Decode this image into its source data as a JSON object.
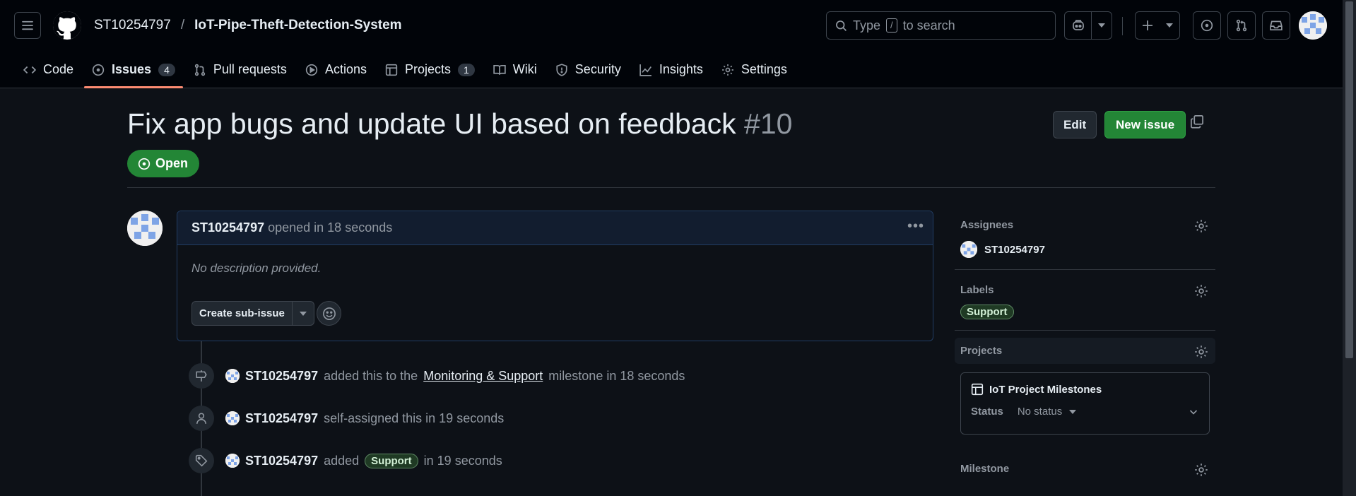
{
  "header": {
    "owner": "ST10254797",
    "separator": "/",
    "repo": "IoT-Pipe-Theft-Detection-System",
    "search_prefix": "Type",
    "search_key": "/",
    "search_suffix": "to search"
  },
  "nav": {
    "tabs": [
      {
        "label": "Code",
        "icon": "code-icon"
      },
      {
        "label": "Issues",
        "icon": "issue-icon",
        "count": "4"
      },
      {
        "label": "Pull requests",
        "icon": "pull-request-icon"
      },
      {
        "label": "Actions",
        "icon": "play-icon"
      },
      {
        "label": "Projects",
        "icon": "table-icon",
        "count": "1"
      },
      {
        "label": "Wiki",
        "icon": "book-icon"
      },
      {
        "label": "Security",
        "icon": "shield-icon"
      },
      {
        "label": "Insights",
        "icon": "graph-icon"
      },
      {
        "label": "Settings",
        "icon": "gear-icon"
      }
    ]
  },
  "issue": {
    "title": "Fix app bugs and update UI based on feedback",
    "number": "#10",
    "state": "Open",
    "edit_label": "Edit",
    "new_issue_label": "New issue"
  },
  "comment": {
    "author": "ST10254797",
    "meta": "opened in 18 seconds",
    "body": "No description provided.",
    "sub_issue_label": "Create sub-issue"
  },
  "events": [
    {
      "user": "ST10254797",
      "pre": "added this to the",
      "link": "Monitoring & Support",
      "post": "milestone in 18 seconds"
    },
    {
      "user": "ST10254797",
      "text": "self-assigned this in 19 seconds"
    },
    {
      "user": "ST10254797",
      "pre": "added",
      "label": "Support",
      "post": "in 19 seconds"
    }
  ],
  "sidebar": {
    "assignees_heading": "Assignees",
    "assignee": "ST10254797",
    "labels_heading": "Labels",
    "label": "Support",
    "projects_heading": "Projects",
    "project_name": "IoT Project Milestones",
    "status_key": "Status",
    "status_value": "No status",
    "milestone_heading": "Milestone"
  }
}
